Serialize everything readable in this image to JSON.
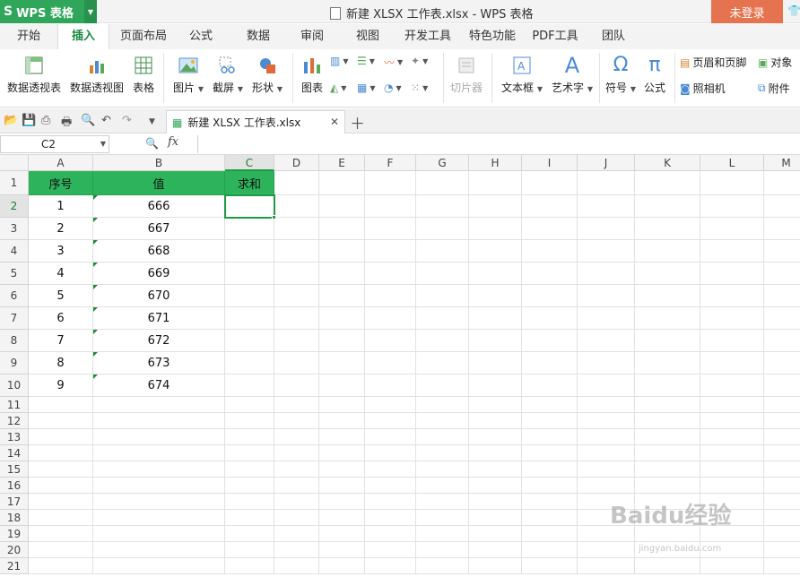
{
  "app": {
    "name": "WPS 表格",
    "logo_glyph": "S",
    "window_title": "新建 XLSX 工作表.xlsx - WPS 表格",
    "login_label": "未登录",
    "accent_color": "#2fa65a",
    "login_color": "#e6734f"
  },
  "menu_tabs": [
    "开始",
    "插入",
    "页面布局",
    "公式",
    "数据",
    "审阅",
    "视图",
    "开发工具",
    "特色功能",
    "PDF工具",
    "团队"
  ],
  "active_tab": "插入",
  "ribbon": {
    "pivot_table": "数据透视表",
    "pivot_chart": "数据透视图",
    "table": "表格",
    "picture": "图片",
    "screenshot": "截屏",
    "shape": "形状",
    "chart": "图表",
    "slicer": "切片器",
    "textbox": "文本框",
    "wordart": "艺术字",
    "symbol": "符号",
    "formula": "公式",
    "header_footer": "页眉和页脚",
    "camera": "照相机",
    "object": "对象",
    "attachment": "附件"
  },
  "document_tab": "新建 XLSX 工作表.xlsx",
  "formula_bar": {
    "name_box": "C2",
    "fx_label": "fx",
    "value": ""
  },
  "sheet": {
    "columns": [
      "A",
      "B",
      "C",
      "D",
      "E",
      "F",
      "G",
      "H",
      "I",
      "J",
      "K",
      "L",
      "M"
    ],
    "rows": [
      "1",
      "2",
      "3",
      "4",
      "5",
      "6",
      "7",
      "8",
      "9",
      "10",
      "11",
      "12",
      "13",
      "14",
      "15",
      "16",
      "17",
      "18",
      "19",
      "20",
      "21"
    ],
    "selected_cell": "C2",
    "header_row": [
      "序号",
      "值",
      "求和"
    ],
    "data_rows": [
      [
        "1",
        "666"
      ],
      [
        "2",
        "667"
      ],
      [
        "3",
        "668"
      ],
      [
        "4",
        "669"
      ],
      [
        "5",
        "670"
      ],
      [
        "6",
        "671"
      ],
      [
        "7",
        "672"
      ],
      [
        "8",
        "673"
      ],
      [
        "9",
        "674"
      ]
    ]
  },
  "watermark": {
    "main": "Baidu经验",
    "sub": "jingyan.baidu.com"
  }
}
